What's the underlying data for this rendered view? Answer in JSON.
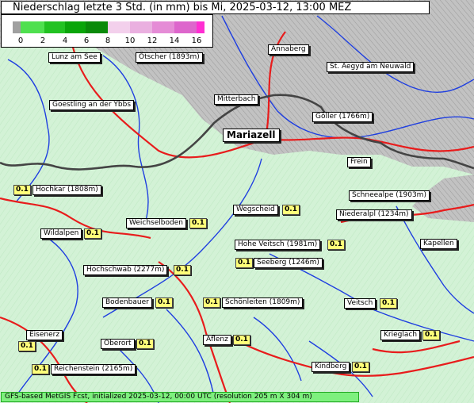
{
  "title": "Niederschlag letzte 3 Std. (in mm) bis Mi, 2025-03-12, 13:00 MEZ",
  "legend": {
    "ticks": [
      "0",
      "2",
      "4",
      "6",
      "8",
      "10",
      "12",
      "14",
      "16"
    ],
    "colors": [
      "#a0a0a0",
      "#4fe04f",
      "#22c222",
      "#0aa50a",
      "#f0c8e8",
      "#e8a0d8",
      "#e070cc",
      "#ff2ed2"
    ]
  },
  "places": [
    {
      "id": "lunz",
      "name": "Lunz am See"
    },
    {
      "id": "oetscher",
      "name": "Ötscher (1893m)"
    },
    {
      "id": "annaberg",
      "name": "Annaberg"
    },
    {
      "id": "aegyd",
      "name": "St. Aegyd am Neuwald"
    },
    {
      "id": "goestling",
      "name": "Goestling an der Ybbs"
    },
    {
      "id": "mitterbach",
      "name": "Mitterbach"
    },
    {
      "id": "mariazell",
      "name": "Mariazell"
    },
    {
      "id": "goeller",
      "name": "Göller (1766m)"
    },
    {
      "id": "frein",
      "name": "Frein"
    },
    {
      "id": "hochkar",
      "name": "Hochkar (1808m)",
      "value": "0.1"
    },
    {
      "id": "schneealpe",
      "name": "Schneealpe (1903m)"
    },
    {
      "id": "wegscheid",
      "name": "Wegscheid",
      "value": "0.1"
    },
    {
      "id": "niederalpl",
      "name": "Niederalpl (1234m)"
    },
    {
      "id": "weichselboden",
      "name": "Weichselboden",
      "value": "0.1"
    },
    {
      "id": "wildalpen",
      "name": "Wildalpen",
      "value": "0.1"
    },
    {
      "id": "hoheveitsch",
      "name": "Hohe Veitsch (1981m)",
      "value": "0.1"
    },
    {
      "id": "kapellen",
      "name": "Kapellen"
    },
    {
      "id": "seeberg",
      "name": "Seeberg (1246m)",
      "value": "0.1"
    },
    {
      "id": "hochschwab",
      "name": "Hochschwab (2277m)",
      "value": "0.1"
    },
    {
      "id": "bodenbauer",
      "name": "Bodenbauer",
      "value": "0.1"
    },
    {
      "id": "schoenleiten",
      "name": "Schönleiten (1809m)",
      "value": "0.1"
    },
    {
      "id": "veitsch",
      "name": "Veitsch",
      "value": "0.1"
    },
    {
      "id": "eisenerz",
      "name": "Eisenerz",
      "value": "0.1"
    },
    {
      "id": "oberort",
      "name": "Oberort",
      "value": "0.1"
    },
    {
      "id": "aflenz",
      "name": "Aflenz",
      "value": "0.1"
    },
    {
      "id": "krieglach",
      "name": "Krieglach",
      "value": "0.1"
    },
    {
      "id": "reichenstein",
      "name": "Reichenstein (2165m)",
      "value": "0.1"
    },
    {
      "id": "kindberg",
      "name": "Kindberg",
      "value": "0.1"
    }
  ],
  "footer": "GFS-based MetGIS Fcst, initialized 2025-03-12, 00:00 UTC  (resolution 205 m X 304 m)"
}
